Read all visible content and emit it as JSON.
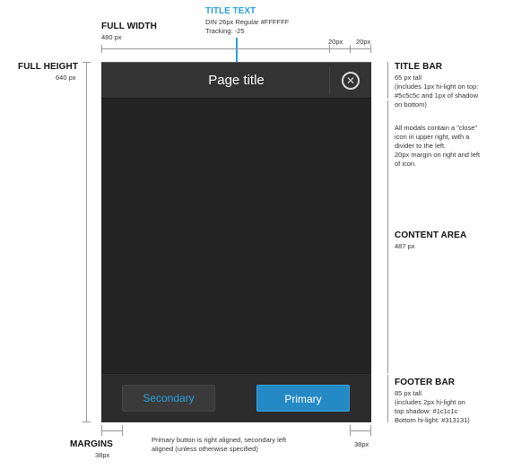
{
  "annotations": {
    "title_text": {
      "heading": "TITLE TEXT",
      "lines": [
        "DIN 26px Regular #FFFFFF",
        "Tracking: -25"
      ]
    },
    "full_width": {
      "heading": "FULL WIDTH",
      "value": "480 px"
    },
    "full_height": {
      "heading": "FULL HEIGHT",
      "value": "640 px"
    },
    "spacing_right_a": "20px",
    "spacing_right_b": "20px",
    "title_bar": {
      "heading": "TITLE BAR",
      "lines": [
        "65 px tall",
        "(includes 1px hi-light on top:",
        "#5c5c5c and 1px of shadow",
        "on bottom)"
      ],
      "note": [
        "All modals contain a \"close\"",
        "icon in upper right, with a",
        "divider to the left.",
        "20px margin on right and left",
        "of icon."
      ]
    },
    "content_area": {
      "heading": "CONTENT AREA",
      "value": "487 px"
    },
    "footer_bar": {
      "heading": "FOOTER BAR",
      "lines": [
        "85 px tall",
        "(includes 2px hi-light on",
        "top shadow: #1c1c1c",
        "Bottom hi-light: #313131)"
      ]
    },
    "margins": {
      "heading": "MARGINS",
      "left_value": "38px",
      "right_value": "38px"
    },
    "footer_note": [
      "Primary button is right aligned, secondary left",
      "aligned (unless otherwise specified)"
    ]
  },
  "modal": {
    "title": "Page title",
    "close_glyph": "✕",
    "secondary_label": "Secondary",
    "primary_label": "Primary"
  },
  "colors": {
    "title_text": "#FFFFFF",
    "title_highlight": "#5c5c5c",
    "footer_shadow": "#1c1c1c",
    "footer_highlight": "#313131",
    "accent": "#2aa0dc"
  }
}
